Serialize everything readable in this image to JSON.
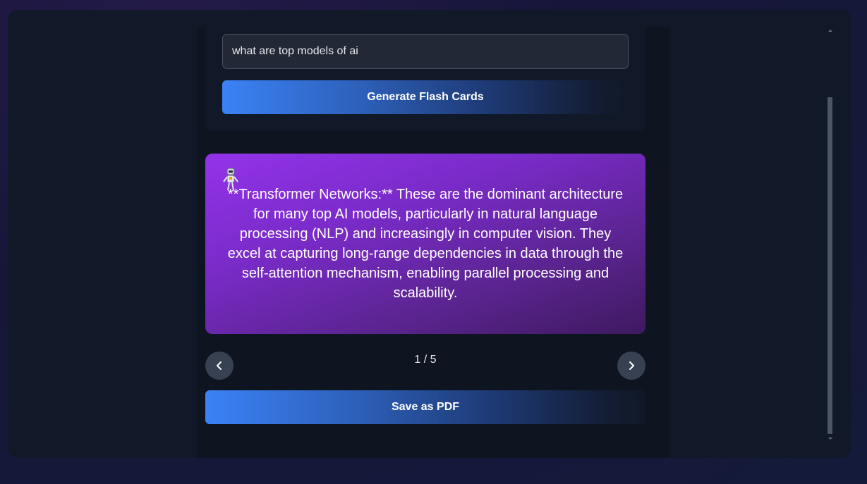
{
  "prompt": {
    "value": "what are top models of ai"
  },
  "generate_button": {
    "label": "Generate Flash Cards"
  },
  "flashcard": {
    "icon": "robot-icon",
    "text": "**Transformer Networks:** These are the dominant architecture for many top AI models, particularly in natural language processing (NLP) and increasingly in computer vision. They excel at capturing long-range dependencies in data through the self-attention mechanism, enabling parallel processing and scalability."
  },
  "navigation": {
    "prev_icon": "chevron-left-icon",
    "next_icon": "chevron-right-icon",
    "counter": "1 / 5"
  },
  "save_button": {
    "label": "Save as PDF"
  },
  "colors": {
    "accent_blue": "#3b82f6",
    "card_purple": "#9333ea",
    "panel_dark": "#111827",
    "page_background": "#17163a"
  }
}
